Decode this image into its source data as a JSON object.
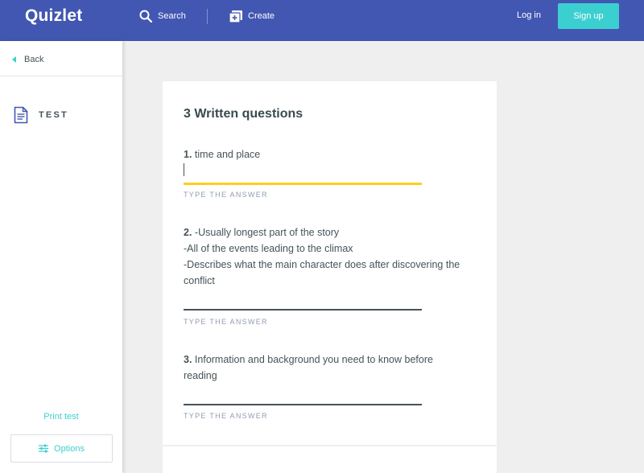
{
  "header": {
    "logo": "Quizlet",
    "search_label": "Search",
    "create_label": "Create",
    "login_label": "Log in",
    "signup_label": "Sign up"
  },
  "sidebar": {
    "back_label": "Back",
    "mode_label": "TEST",
    "print_label": "Print test",
    "options_label": "Options"
  },
  "main": {
    "section_title": "3 Written questions",
    "answer_hint": "TYPE THE ANSWER",
    "questions": [
      {
        "number": "1.",
        "lines": [
          "time and place"
        ]
      },
      {
        "number": "2.",
        "lines": [
          "-Usually longest part of the story",
          "-All of the events leading to the climax",
          "-Describes what the main character does after discovering the",
          "conflict"
        ]
      },
      {
        "number": "3.",
        "lines": [
          "Information and background you need to know before",
          "reading"
        ]
      }
    ]
  },
  "colors": {
    "header_bg": "#4257b2",
    "accent": "#3ccfcf",
    "active_underline": "#ffcd1f",
    "text": "#455358",
    "page_bg": "#efefef"
  }
}
